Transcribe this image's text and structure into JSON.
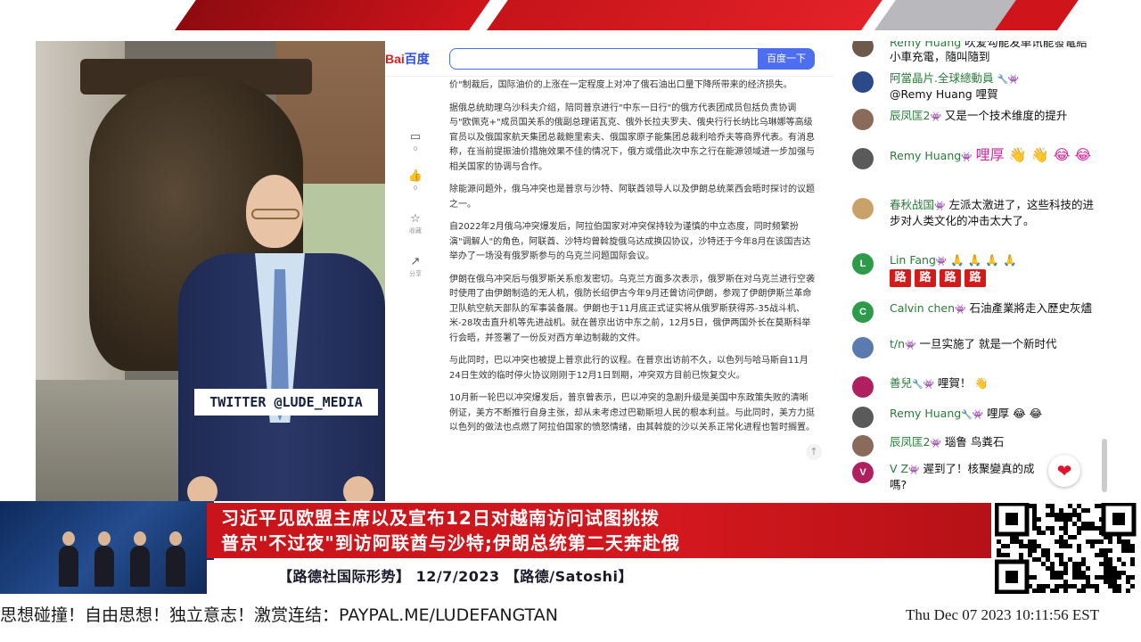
{
  "video": {
    "twitter_label": "TWITTER  @LUDE_MEDIA"
  },
  "article": {
    "logo_bai": "Bai",
    "logo_du": "百度",
    "search_value": "",
    "search_button": "百度一下",
    "tools": [
      {
        "icon": "comment-icon",
        "glyph": "▭",
        "count": "0"
      },
      {
        "icon": "thumbs-up-icon",
        "glyph": "👍",
        "count": "0"
      },
      {
        "icon": "star-icon",
        "glyph": "☆",
        "count": "收藏"
      },
      {
        "icon": "share-icon",
        "glyph": "↗",
        "count": "分享"
      }
    ],
    "paragraphs": [
      "价\"制裁后，国际油价的上涨在一定程度上对冲了俄石油出口量下降所带来的经济损失。",
      "据俄总统助理乌沙科夫介绍，陪同普京进行\"中东一日行\"的俄方代表团成员包括负责协调与\"欧佩克+\"成员国关系的俄副总理诺瓦克、俄外长拉夫罗夫、俄央行行长纳比乌琳娜等高级官员以及俄国家航天集团总裁鲍里索夫、俄国家原子能集团总裁利哈乔夫等商界代表。有消息称，在当前提振油价措施效果不佳的情况下，俄方或借此次中东之行在能源领域进一步加强与相关国家的协调与合作。",
      "除能源问题外，俄乌冲突也是普京与沙特、阿联酋领导人以及伊朗总统莱西会晤时探讨的议题之一。",
      "自2022年2月俄乌冲突爆发后，阿拉伯国家对冲突保持较为谨慎的中立态度，同时频繁扮演\"调解人\"的角色，阿联酋、沙特均曾斡旋俄乌达成换囚协议，沙特还于今年8月在该国吉达举办了一场没有俄罗斯参与的乌克兰问题国际会议。",
      "伊朗在俄乌冲突后与俄罗斯关系愈发密切。乌克兰方面多次表示，俄罗斯在对乌克兰进行空袭时使用了由伊朗制造的无人机，俄防长绍伊古今年9月还曾访问伊朗，参观了伊朗伊斯兰革命卫队航空航天部队的军事装备展。伊朗也于11月底正式证实将从俄罗斯获得苏-35战斗机、米-28攻击直升机等先进战机。就在普京出访中东之前，12月5日，俄伊两国外长在莫斯科举行会晤，并签署了一份反对西方单边制裁的文件。",
      "与此同时，巴以冲突也被提上普京此行的议程。在普京出访前不久，以色列与哈马斯自11月24日生效的临时停火协议刚刚于12月1日到期，冲突双方目前已恢复交火。",
      "10月新一轮巴以冲突爆发后，普京曾表示，巴以冲突的急剧升级是美国中东政策失败的清晰例证，美方不断推行自身主张，却从未考虑过巴勒斯坦人民的根本利益。与此同时，美方力挺以色列的做法也点燃了阿拉伯国家的愤怒情绪，由其斡旋的沙以关系正常化进程也暂时搁置。"
    ],
    "scroll_top_glyph": "↑"
  },
  "chat": {
    "messages": [
      {
        "avatar_color": "#6d5a4a",
        "avatar_text": "",
        "author": "Remy Huang",
        "badge": "",
        "text": "吹爱勾能发单讯能發電給小車充電，隨叫隨到"
      },
      {
        "avatar_color": "#2c4a8a",
        "avatar_text": "",
        "author": "阿當晶片.全球總動員",
        "badge": "🔧👾",
        "text": "@Remy Huang 哩賀"
      },
      {
        "avatar_color": "#8a6a5a",
        "avatar_text": "",
        "author": "辰凤匡2",
        "badge": "👾",
        "text": "又是一个技术维度的提升"
      },
      {
        "avatar_color": "#5a5a5a",
        "avatar_text": "",
        "author": "Remy Huang",
        "badge": "👾",
        "text": "哩厚 👋 👋 😂 😂"
      },
      {
        "avatar_color": "#c9a26a",
        "avatar_text": "",
        "author": "春秋战国",
        "badge": "👾",
        "text": "左派太激进了，这些科技的进步对人类文化的冲击太大了。"
      },
      {
        "avatar_color": "#2e9b4a",
        "avatar_text": "L",
        "author": "Lin Fang",
        "badge": "👾",
        "text": "🙏 🙏 🙏 🙏"
      },
      {
        "avatar_color": "#2e9b4a",
        "avatar_text": "C",
        "author": "Calvin chen",
        "badge": "👾",
        "text": "石油產業將走入歷史灰燼"
      },
      {
        "avatar_color": "#5a7ab0",
        "avatar_text": "",
        "author": "t/n",
        "badge": "👾",
        "text": "一旦实施了 就是一个新时代"
      },
      {
        "avatar_color": "#b02060",
        "avatar_text": "",
        "author": "善兒",
        "badge": "🔧👾",
        "text": "哩賀！ 👋"
      },
      {
        "avatar_color": "#5a5a5a",
        "avatar_text": "",
        "author": "Remy Huang",
        "badge": "🔧👾",
        "text": "哩厚 😂 😂"
      },
      {
        "avatar_color": "#8a6a5a",
        "avatar_text": "",
        "author": "辰凤匡2",
        "badge": "👾",
        "text": "瑙鲁 鸟粪石"
      },
      {
        "avatar_color": "#b02060",
        "avatar_text": "V",
        "author": "V Z",
        "badge": "👾",
        "text": "遲到了！核聚變真的成嗎?"
      }
    ],
    "road_chars": [
      "路",
      "路",
      "路",
      "路"
    ],
    "heart_glyph": "❤"
  },
  "banner": {
    "headline_1": "习近平见欧盟主席以及宣布12日对越南访问试图挑拨",
    "headline_2": "普京\"不过夜\"到访阿联酋与沙特;伊朗总统第二天奔赴俄",
    "subtitle": "【路德社国际形势】 12/7/2023 【路德/Satoshi】"
  },
  "footer": {
    "ticker": "思想碰撞！自由思想！独立意志！激赏连结：PAYPAL.ME/LUDEFANGTAN",
    "clock": "Thu Dec 07 2023 10:11:56 EST"
  },
  "colors": {
    "banner_red": "#d3181e",
    "baidu_blue": "#4e6ef2",
    "chat_author": "#2b7a3b"
  }
}
